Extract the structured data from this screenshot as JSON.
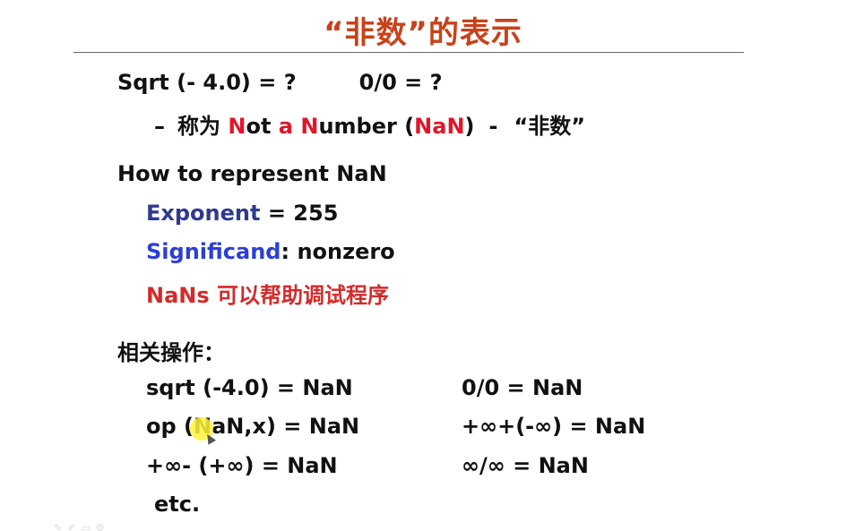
{
  "title": "“非数”的表示",
  "intro": {
    "q1": "Sqrt (- 4.0) = ?",
    "q2": "0/0 = ?",
    "dash": "–",
    "called": "称为",
    "n1": "N",
    "not_rest": "ot",
    "a": "a",
    "n2": "N",
    "umber_rest": "umber",
    "paren_open": "(",
    "nan": "NaN",
    "paren_close": ")",
    "sep": "-",
    "cn_nan": "“非数”"
  },
  "represent": {
    "heading": "How to represent NaN",
    "exponent_label": "Exponent",
    "exponent_value": "= 255",
    "significand_label": "Significand",
    "significand_value": ":  nonzero",
    "debug_note": "NaNs 可以帮助调试程序"
  },
  "operations": {
    "heading": "相关操作：",
    "left": [
      "sqrt (-4.0) = NaN",
      "op (NaN,x) = NaN",
      "+∞- (+∞) = NaN"
    ],
    "right": [
      "0/0 = NaN",
      "+∞+(-∞) = NaN",
      "∞/∞ = NaN"
    ],
    "etc": "etc."
  },
  "toolbar_icons": [
    "pen-icon",
    "pencil-icon",
    "notes-icon",
    "settings-icon"
  ],
  "colors": {
    "title": "#c8421a",
    "nan_letter": "#e0162b",
    "exponent": "#2f3a8f",
    "significand": "#2b3fd6",
    "debug_note": "#d42a2a"
  }
}
